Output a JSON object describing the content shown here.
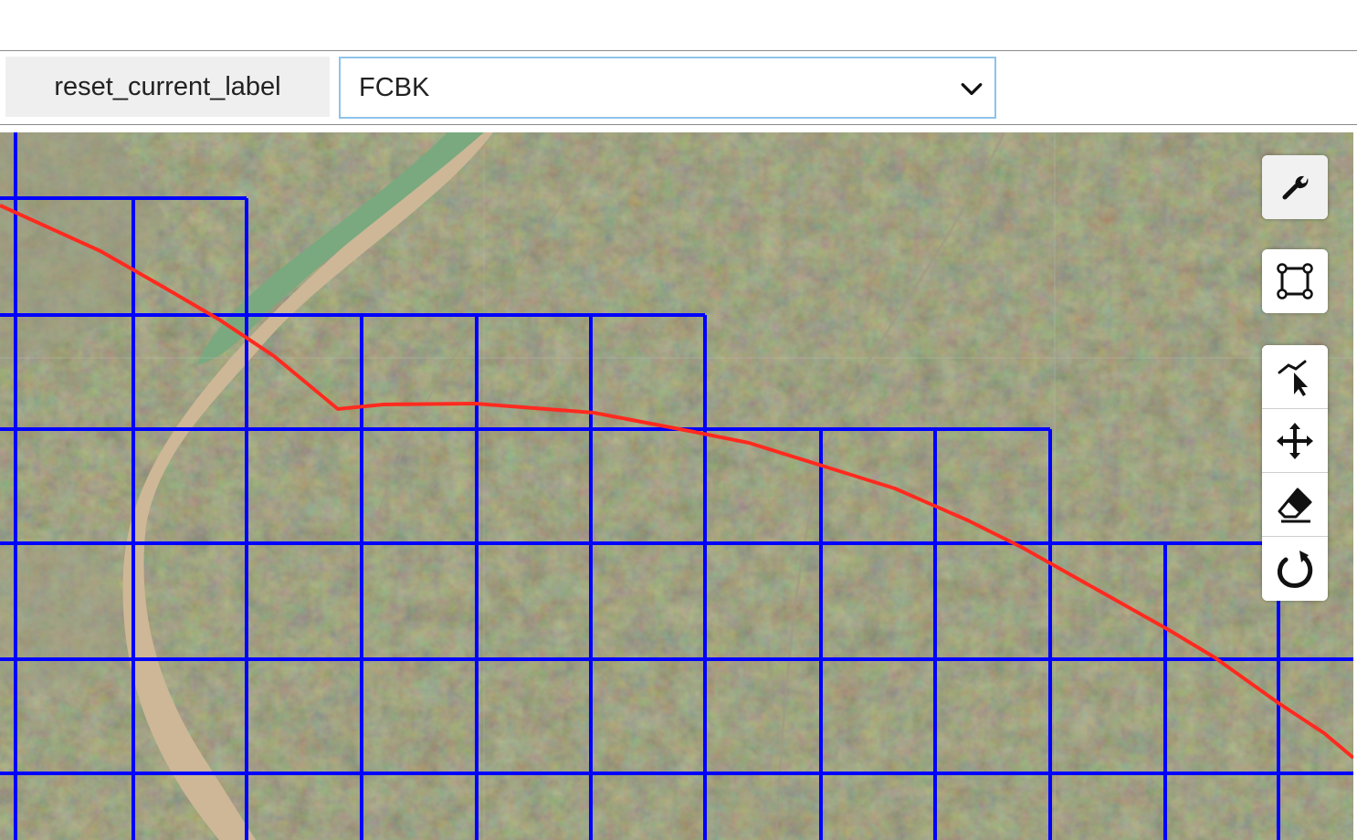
{
  "toolbar": {
    "reset_label": "reset_current_label",
    "label_select": {
      "value": "FCBK",
      "options": [
        "FCBK"
      ]
    }
  },
  "map": {
    "grid_color": "#0000ff",
    "route_color": "#ff2a1f",
    "tools": [
      {
        "name": "settings",
        "icon": "wrench-icon",
        "active": true
      },
      {
        "name": "draw-rectangle",
        "icon": "rectangle-draw-icon",
        "active": false
      },
      {
        "name": "edit-vertices",
        "icon": "edit-cursor-icon",
        "active": false
      },
      {
        "name": "move",
        "icon": "move-arrows-icon",
        "active": false
      },
      {
        "name": "erase",
        "icon": "eraser-icon",
        "active": false
      },
      {
        "name": "rotate",
        "icon": "rotate-icon",
        "active": false
      }
    ]
  }
}
